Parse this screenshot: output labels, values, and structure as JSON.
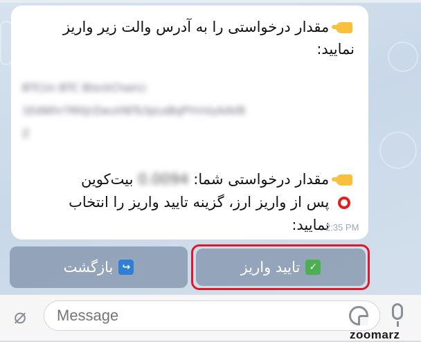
{
  "message": {
    "line1": "مقدار درخواستی را به آدرس والت زیر واریز",
    "line2": "نمایید:",
    "address_line1": "BTC(in BTC BlockChain):",
    "address_line2": "1EdWhr7MXJrZwuVWTs3pLeBqPYmVyAAVB",
    "address_line3": "Z",
    "amount_label": "مقدار درخواستی شما:",
    "amount_value": "0.0094",
    "amount_unit": "بیت‌کوین",
    "after_line1": "پس از واریز ارز، گزینه تایید واریز را انتخاب",
    "after_line2": "نمایید:",
    "time": "2:35 PM",
    "icons": {
      "pointer": "backhand-index-pointing-left-icon",
      "circle": "red-hollow-circle-icon"
    }
  },
  "keyboard": {
    "back_label": "بازگشت",
    "back_icon": "↪",
    "confirm_label": "تایید واریز",
    "confirm_icon": "✓",
    "highlight_color": "#e0162b"
  },
  "input": {
    "placeholder": "Message"
  },
  "watermark": "zoomarz"
}
